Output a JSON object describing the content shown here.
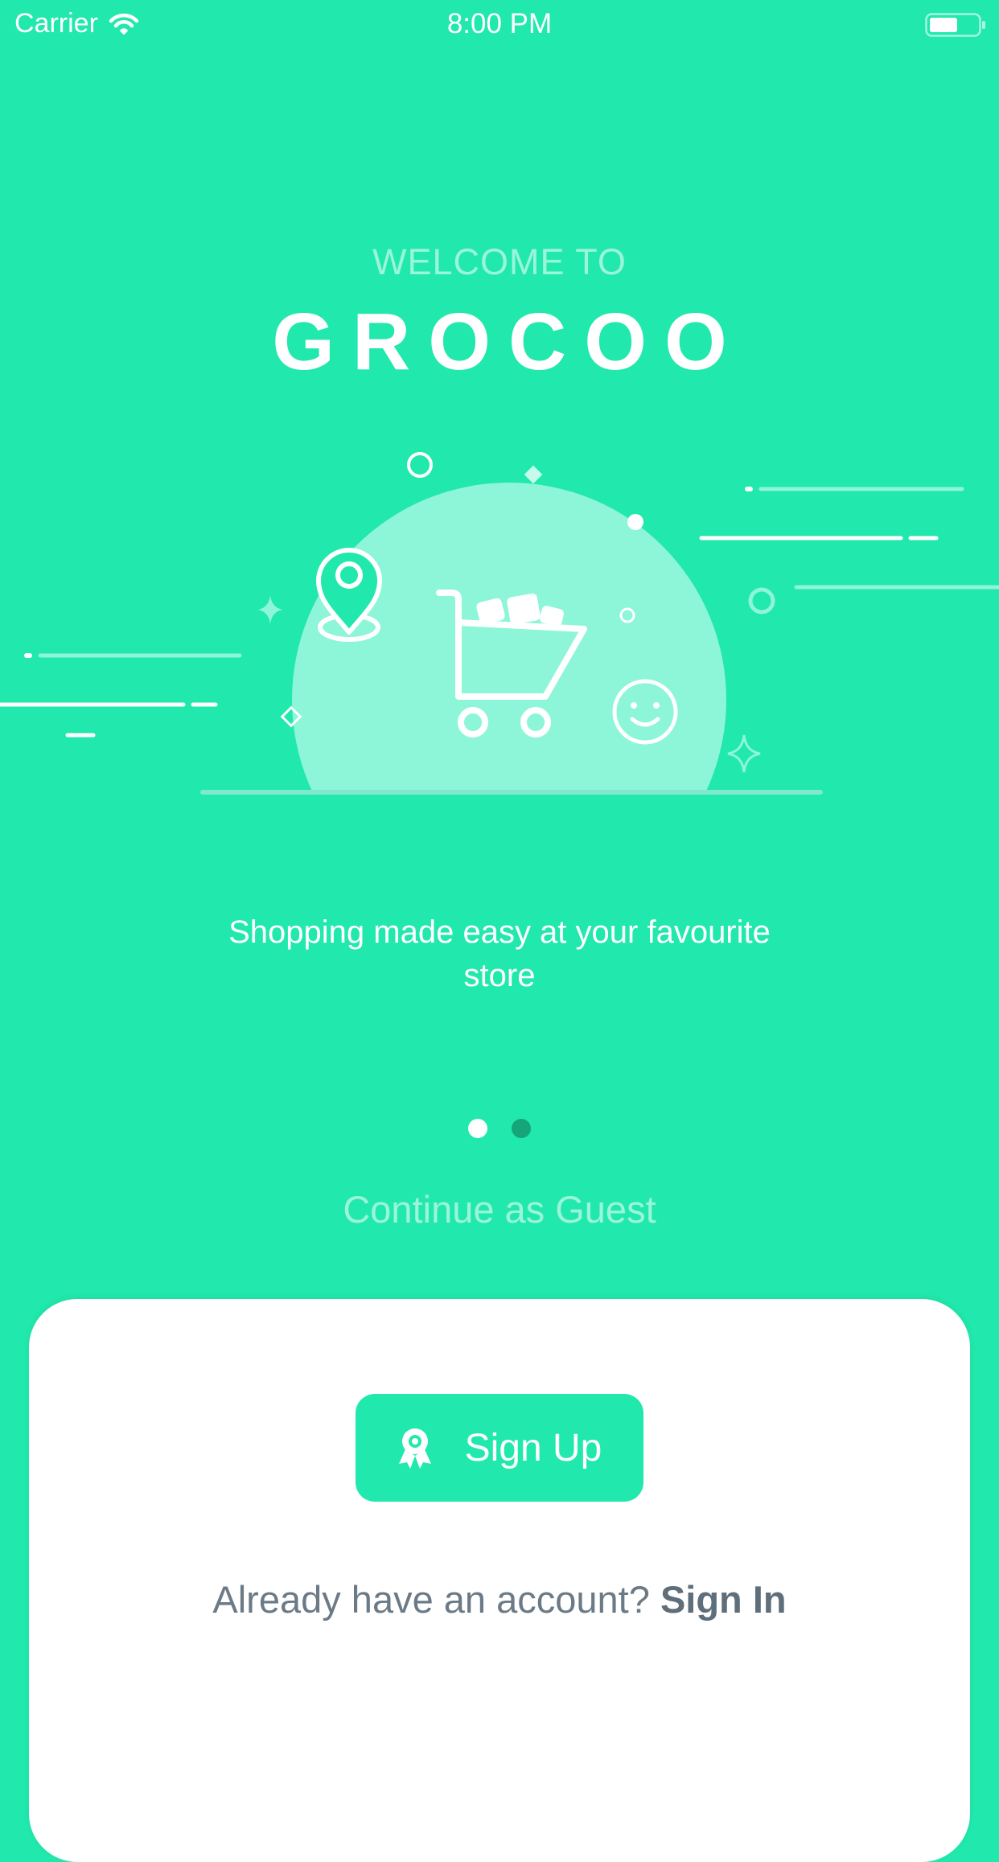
{
  "status_bar": {
    "carrier": "Carrier",
    "time": "8:00 PM",
    "icons": [
      "wifi-icon",
      "battery-icon"
    ]
  },
  "hero": {
    "welcome": "WELCOME TO",
    "brand": "GROCOO",
    "illustration_icons": [
      "shopping-cart-icon",
      "location-pin-icon",
      "smiley-face-icon",
      "sparkle-icon"
    ]
  },
  "tagline": "Shopping made easy at your favourite store",
  "pager": {
    "total": 2,
    "active_index": 0
  },
  "guest_link": "Continue as Guest",
  "auth_card": {
    "signup_label": "Sign Up",
    "signup_icon": "award-ribbon-icon",
    "signin_prompt": "Already have an account?",
    "signin_link": "Sign In"
  },
  "colors": {
    "background": "#21E8AC",
    "circle": "#8DF5D8",
    "card": "#FFFFFF",
    "text_gray": "#6B7A86",
    "dot_inactive": "#16A579"
  }
}
